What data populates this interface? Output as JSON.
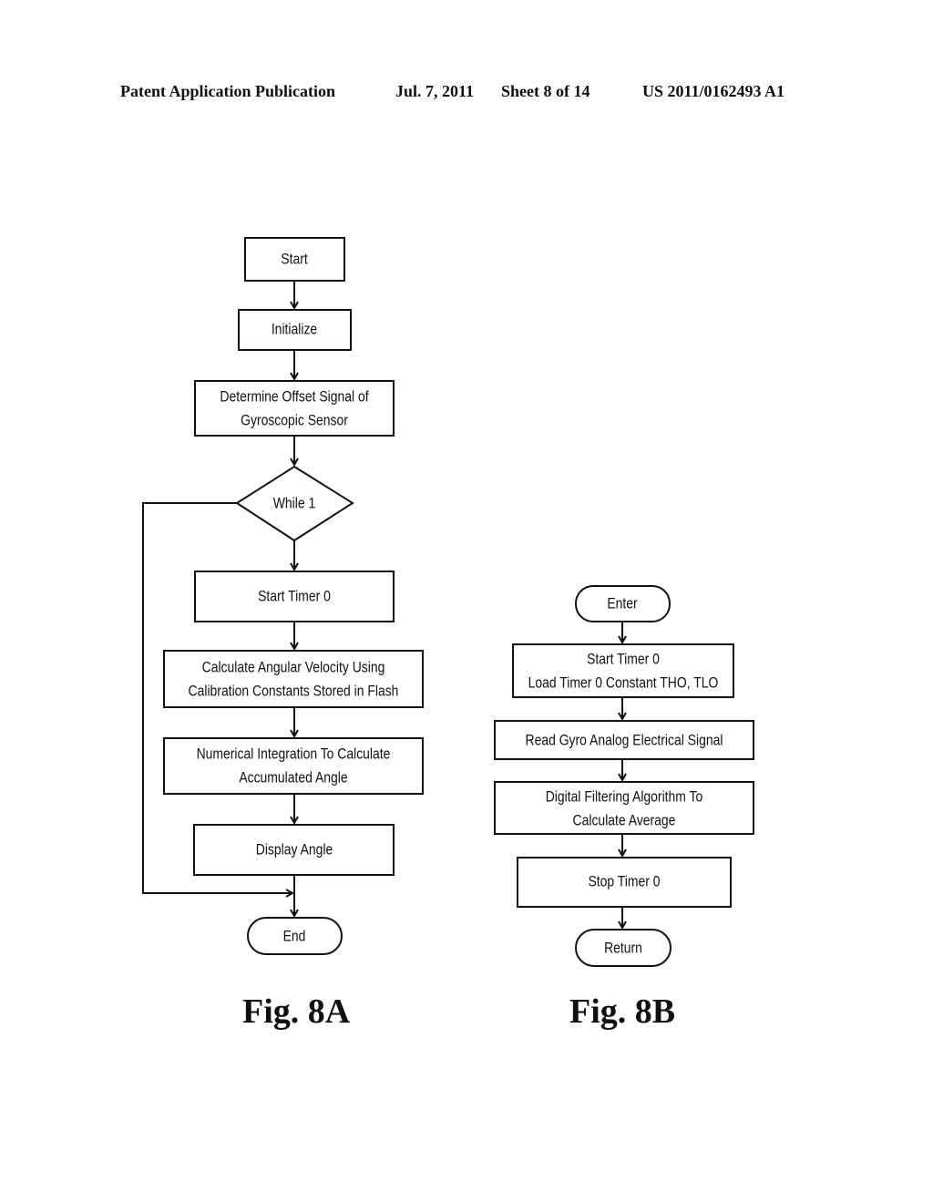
{
  "header": {
    "publication": "Patent Application Publication",
    "date": "Jul. 7, 2011",
    "sheet": "Sheet 8 of 14",
    "number": "US 2011/0162493 A1"
  },
  "fig8a": {
    "caption": "Fig. 8A",
    "nodes": {
      "start": [
        "Start"
      ],
      "initialize": [
        "Initialize"
      ],
      "offset": [
        "Determine Offset Signal of",
        "Gyroscopic Sensor"
      ],
      "while": [
        "While 1"
      ],
      "timer": [
        "Start Timer 0"
      ],
      "velocity": [
        "Calculate Angular Velocity Using",
        "Calibration Constants Stored in Flash"
      ],
      "integration": [
        "Numerical Integration To Calculate",
        "Accumulated Angle"
      ],
      "display": [
        "Display Angle"
      ],
      "end": [
        "End"
      ]
    }
  },
  "fig8b": {
    "caption": "Fig. 8B",
    "nodes": {
      "enter": [
        "Enter"
      ],
      "timer": [
        "Start Timer 0",
        "Load Timer 0 Constant THO, TLO"
      ],
      "read": [
        "Read Gyro Analog Electrical Signal"
      ],
      "filter": [
        "Digital Filtering Algorithm To",
        "Calculate Average"
      ],
      "stop": [
        "Stop Timer 0"
      ],
      "return": [
        "Return"
      ]
    }
  }
}
